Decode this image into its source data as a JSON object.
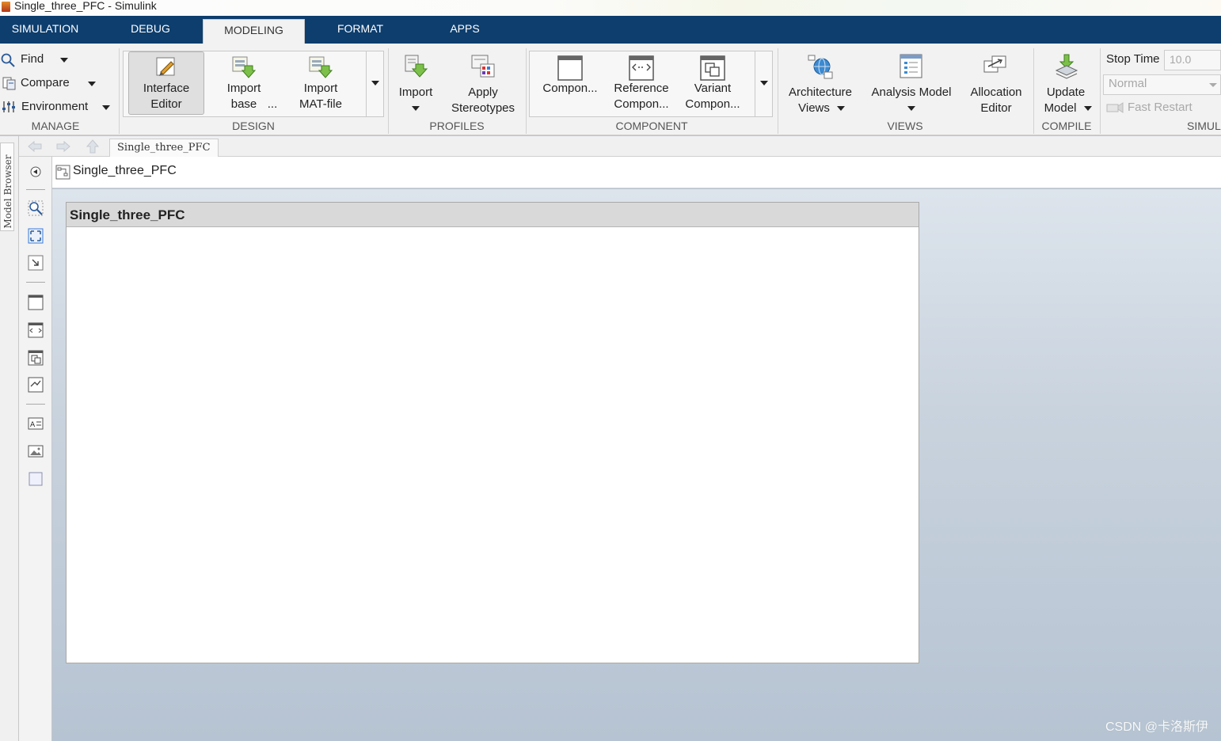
{
  "window": {
    "title": "Single_three_PFC - Simulink"
  },
  "tabs": [
    {
      "label": "SIMULATION"
    },
    {
      "label": "DEBUG"
    },
    {
      "label": "MODELING"
    },
    {
      "label": "FORMAT"
    },
    {
      "label": "APPS"
    }
  ],
  "ribbon": {
    "manage": {
      "find": "Find",
      "compare": "Compare",
      "environment": "Environment",
      "label": "MANAGE"
    },
    "design": {
      "interface_editor_l1": "Interface",
      "interface_editor_l2": "Editor",
      "import_base_l1": "Import",
      "import_base_l2": "base",
      "import_base_more": "...",
      "import_mat_l1": "Import",
      "import_mat_l2": "MAT-file",
      "label": "DESIGN"
    },
    "profiles": {
      "import": "Import",
      "apply_l1": "Apply",
      "apply_l2": "Stereotypes",
      "label": "PROFILES"
    },
    "component": {
      "component": "Compon...",
      "reference_l1": "Reference",
      "reference_l2": "Compon...",
      "variant_l1": "Variant",
      "variant_l2": "Compon...",
      "label": "COMPONENT"
    },
    "views": {
      "arch_l1": "Architecture",
      "arch_l2": "Views",
      "analysis": "Analysis Model",
      "alloc_l1": "Allocation",
      "alloc_l2": "Editor",
      "label": "VIEWS"
    },
    "compile": {
      "update_l1": "Update",
      "update_l2": "Model",
      "label": "COMPILE"
    },
    "simulate": {
      "stop_time_label": "Stop Time",
      "stop_time_value": "10.0",
      "mode": "Normal",
      "fast_restart": "Fast Restart",
      "label": "SIMUL"
    }
  },
  "side": {
    "model_browser": "Model Browser"
  },
  "breadcrumb_tab": "Single_three_PFC",
  "address": "Single_three_PFC",
  "architecture": {
    "title": "Single_three_PFC"
  },
  "watermark": "CSDN @卡洛斯伊"
}
